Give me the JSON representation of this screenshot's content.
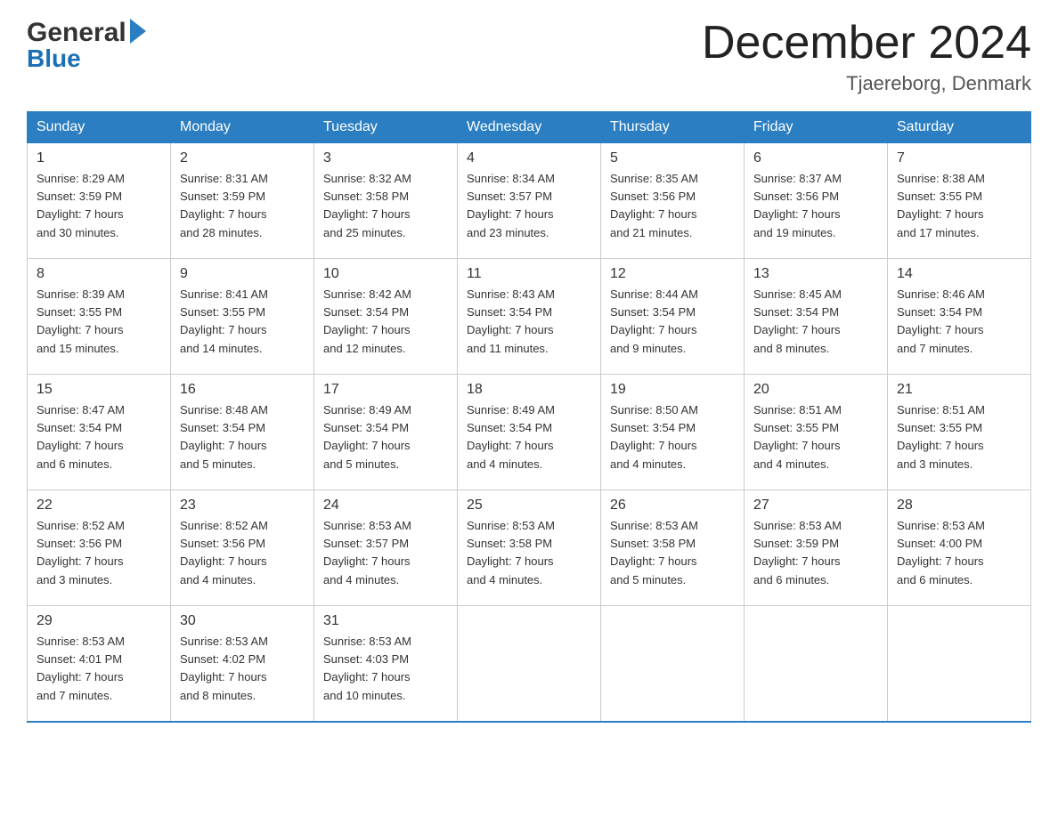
{
  "header": {
    "logo_general": "General",
    "logo_blue": "Blue",
    "title": "December 2024",
    "location": "Tjaereborg, Denmark"
  },
  "days_of_week": [
    "Sunday",
    "Monday",
    "Tuesday",
    "Wednesday",
    "Thursday",
    "Friday",
    "Saturday"
  ],
  "weeks": [
    [
      {
        "day": "1",
        "sunrise": "8:29 AM",
        "sunset": "3:59 PM",
        "daylight": "7 hours and 30 minutes."
      },
      {
        "day": "2",
        "sunrise": "8:31 AM",
        "sunset": "3:59 PM",
        "daylight": "7 hours and 28 minutes."
      },
      {
        "day": "3",
        "sunrise": "8:32 AM",
        "sunset": "3:58 PM",
        "daylight": "7 hours and 25 minutes."
      },
      {
        "day": "4",
        "sunrise": "8:34 AM",
        "sunset": "3:57 PM",
        "daylight": "7 hours and 23 minutes."
      },
      {
        "day": "5",
        "sunrise": "8:35 AM",
        "sunset": "3:56 PM",
        "daylight": "7 hours and 21 minutes."
      },
      {
        "day": "6",
        "sunrise": "8:37 AM",
        "sunset": "3:56 PM",
        "daylight": "7 hours and 19 minutes."
      },
      {
        "day": "7",
        "sunrise": "8:38 AM",
        "sunset": "3:55 PM",
        "daylight": "7 hours and 17 minutes."
      }
    ],
    [
      {
        "day": "8",
        "sunrise": "8:39 AM",
        "sunset": "3:55 PM",
        "daylight": "7 hours and 15 minutes."
      },
      {
        "day": "9",
        "sunrise": "8:41 AM",
        "sunset": "3:55 PM",
        "daylight": "7 hours and 14 minutes."
      },
      {
        "day": "10",
        "sunrise": "8:42 AM",
        "sunset": "3:54 PM",
        "daylight": "7 hours and 12 minutes."
      },
      {
        "day": "11",
        "sunrise": "8:43 AM",
        "sunset": "3:54 PM",
        "daylight": "7 hours and 11 minutes."
      },
      {
        "day": "12",
        "sunrise": "8:44 AM",
        "sunset": "3:54 PM",
        "daylight": "7 hours and 9 minutes."
      },
      {
        "day": "13",
        "sunrise": "8:45 AM",
        "sunset": "3:54 PM",
        "daylight": "7 hours and 8 minutes."
      },
      {
        "day": "14",
        "sunrise": "8:46 AM",
        "sunset": "3:54 PM",
        "daylight": "7 hours and 7 minutes."
      }
    ],
    [
      {
        "day": "15",
        "sunrise": "8:47 AM",
        "sunset": "3:54 PM",
        "daylight": "7 hours and 6 minutes."
      },
      {
        "day": "16",
        "sunrise": "8:48 AM",
        "sunset": "3:54 PM",
        "daylight": "7 hours and 5 minutes."
      },
      {
        "day": "17",
        "sunrise": "8:49 AM",
        "sunset": "3:54 PM",
        "daylight": "7 hours and 5 minutes."
      },
      {
        "day": "18",
        "sunrise": "8:49 AM",
        "sunset": "3:54 PM",
        "daylight": "7 hours and 4 minutes."
      },
      {
        "day": "19",
        "sunrise": "8:50 AM",
        "sunset": "3:54 PM",
        "daylight": "7 hours and 4 minutes."
      },
      {
        "day": "20",
        "sunrise": "8:51 AM",
        "sunset": "3:55 PM",
        "daylight": "7 hours and 4 minutes."
      },
      {
        "day": "21",
        "sunrise": "8:51 AM",
        "sunset": "3:55 PM",
        "daylight": "7 hours and 3 minutes."
      }
    ],
    [
      {
        "day": "22",
        "sunrise": "8:52 AM",
        "sunset": "3:56 PM",
        "daylight": "7 hours and 3 minutes."
      },
      {
        "day": "23",
        "sunrise": "8:52 AM",
        "sunset": "3:56 PM",
        "daylight": "7 hours and 4 minutes."
      },
      {
        "day": "24",
        "sunrise": "8:53 AM",
        "sunset": "3:57 PM",
        "daylight": "7 hours and 4 minutes."
      },
      {
        "day": "25",
        "sunrise": "8:53 AM",
        "sunset": "3:58 PM",
        "daylight": "7 hours and 4 minutes."
      },
      {
        "day": "26",
        "sunrise": "8:53 AM",
        "sunset": "3:58 PM",
        "daylight": "7 hours and 5 minutes."
      },
      {
        "day": "27",
        "sunrise": "8:53 AM",
        "sunset": "3:59 PM",
        "daylight": "7 hours and 6 minutes."
      },
      {
        "day": "28",
        "sunrise": "8:53 AM",
        "sunset": "4:00 PM",
        "daylight": "7 hours and 6 minutes."
      }
    ],
    [
      {
        "day": "29",
        "sunrise": "8:53 AM",
        "sunset": "4:01 PM",
        "daylight": "7 hours and 7 minutes."
      },
      {
        "day": "30",
        "sunrise": "8:53 AM",
        "sunset": "4:02 PM",
        "daylight": "7 hours and 8 minutes."
      },
      {
        "day": "31",
        "sunrise": "8:53 AM",
        "sunset": "4:03 PM",
        "daylight": "7 hours and 10 minutes."
      },
      {
        "day": "",
        "sunrise": "",
        "sunset": "",
        "daylight": ""
      },
      {
        "day": "",
        "sunrise": "",
        "sunset": "",
        "daylight": ""
      },
      {
        "day": "",
        "sunrise": "",
        "sunset": "",
        "daylight": ""
      },
      {
        "day": "",
        "sunrise": "",
        "sunset": "",
        "daylight": ""
      }
    ]
  ],
  "labels": {
    "sunrise_prefix": "Sunrise: ",
    "sunset_prefix": "Sunset: ",
    "daylight_prefix": "Daylight: "
  }
}
